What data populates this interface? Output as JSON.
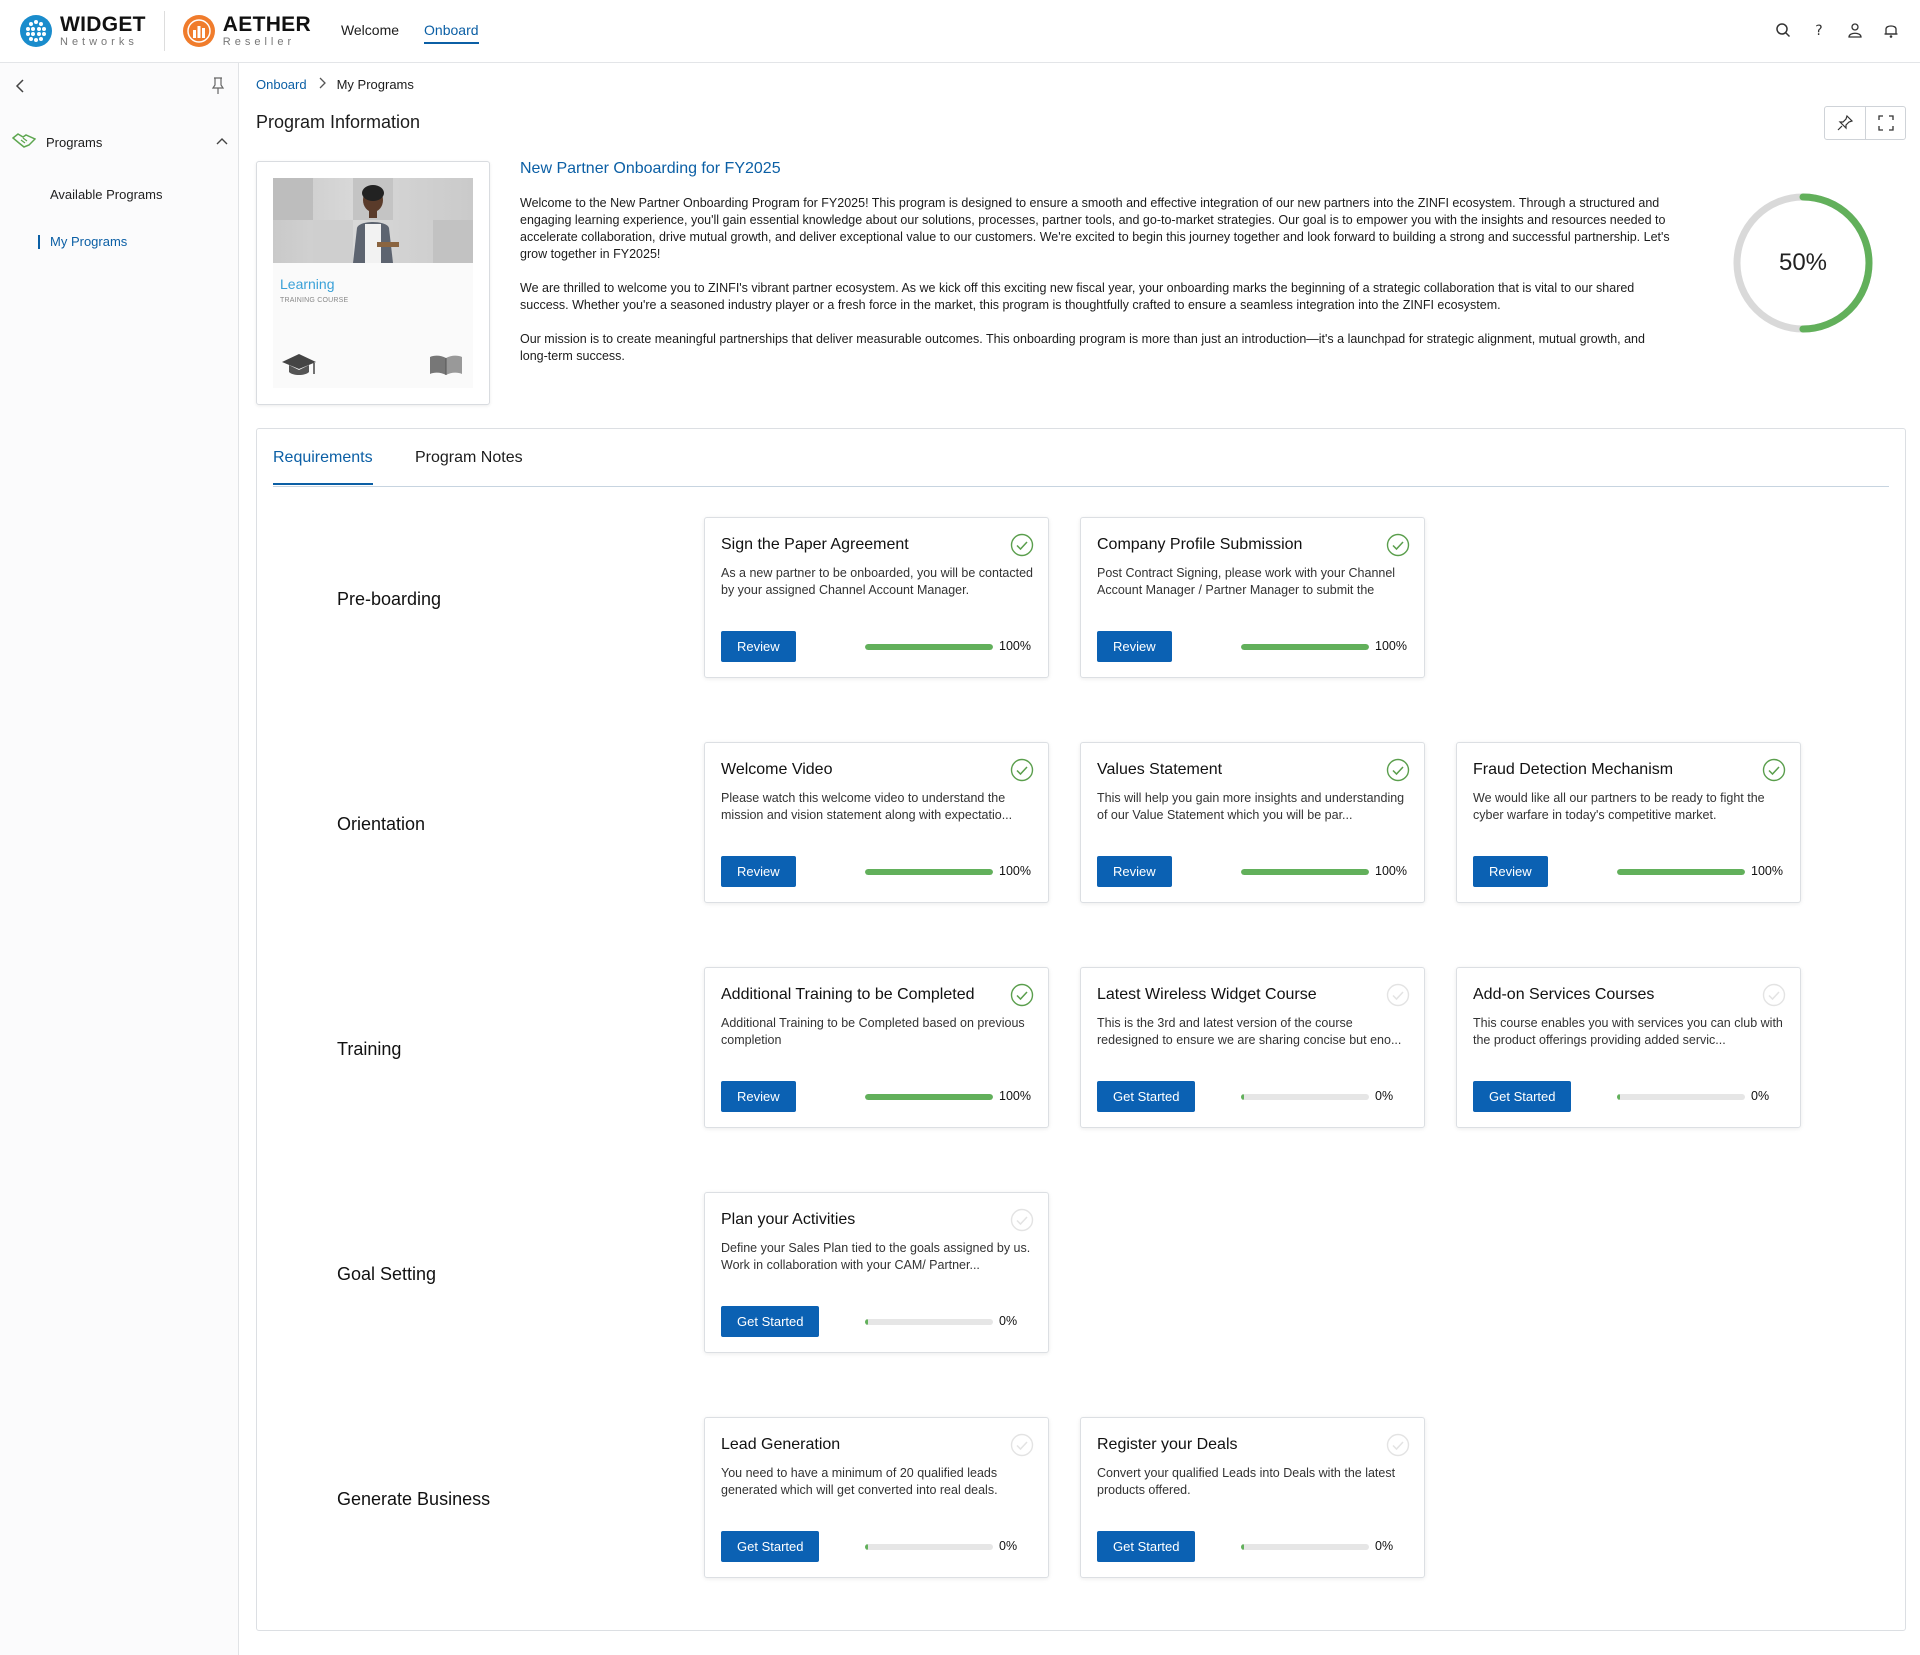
{
  "header": {
    "logo1": {
      "main": "WIDGET",
      "sub": "Networks"
    },
    "logo2": {
      "main": "AETHER",
      "sub": "Reseller"
    },
    "nav": [
      {
        "label": "Welcome",
        "active": false
      },
      {
        "label": "Onboard",
        "active": true
      }
    ],
    "icons": [
      "search-icon",
      "help-icon",
      "user-icon",
      "bell-icon"
    ]
  },
  "sidebar": {
    "section": "Programs",
    "items": [
      {
        "label": "Available Programs",
        "active": false
      },
      {
        "label": "My Programs",
        "active": true
      }
    ]
  },
  "breadcrumb": {
    "root": "Onboard",
    "current": "My Programs"
  },
  "page": {
    "title": "Program Information"
  },
  "program": {
    "thumb_title": "Learning",
    "thumb_subtitle": "TRAINING COURSE",
    "title": "New Partner Onboarding for FY2025",
    "description": [
      "Welcome to the New Partner Onboarding Program for FY2025! This program is designed to ensure a smooth and effective integration of our new partners into the ZINFI ecosystem. Through a structured and engaging learning experience, you'll gain essential knowledge about our solutions, processes, partner tools, and go-to-market strategies. Our goal is to empower you with the insights and resources needed to accelerate collaboration, drive mutual growth, and deliver exceptional value to our customers. We're excited to begin this journey together and look forward to building a strong and successful partnership. Let's grow together in FY2025!",
      "We are thrilled to welcome you to ZINFI's vibrant partner ecosystem. As we kick off this exciting new fiscal year, your onboarding marks the beginning of a strategic collaboration that is vital to our shared success. Whether you're a seasoned industry player or a fresh force in the market, this program is thoughtfully crafted to ensure a seamless integration into the ZINFI ecosystem.",
      "Our mission is to create meaningful partnerships that deliver measurable outcomes. This onboarding program is more than just an introduction—it's a launchpad for strategic alignment, mutual growth, and long-term success."
    ],
    "progress_label": "50%",
    "progress": 0.5
  },
  "tabs": [
    {
      "label": "Requirements",
      "active": true
    },
    {
      "label": "Program Notes",
      "active": false
    }
  ],
  "colors": {
    "accent": "#0b5fa5",
    "button": "#0b61b3",
    "progress": "#62b05b",
    "track": "#d9d9d9"
  },
  "stages": [
    {
      "label": "Pre-boarding",
      "cards": [
        {
          "title": "Sign the Paper Agreement",
          "desc": "As a new partner to be onboarded, you will be contacted by your assigned Channel Account Manager.",
          "button": "Review",
          "progress": 1.0,
          "pct": "100%",
          "done": true
        },
        {
          "title": "Company Profile Submission",
          "desc": "Post Contract Signing, please work with your Channel Account Manager / Partner Manager to submit the",
          "button": "Review",
          "progress": 1.0,
          "pct": "100%",
          "done": true
        }
      ]
    },
    {
      "label": "Orientation",
      "cards": [
        {
          "title": "Welcome Video",
          "desc": "Please watch this welcome video to understand the mission and vision statement along with expectatio...",
          "button": "Review",
          "progress": 1.0,
          "pct": "100%",
          "done": true
        },
        {
          "title": "Values Statement",
          "desc": "This will help you gain more insights and understanding of our Value Statement which you will be par...",
          "button": "Review",
          "progress": 1.0,
          "pct": "100%",
          "done": true
        },
        {
          "title": "Fraud Detection Mechanism",
          "desc": "We would like all our partners to be ready to fight the cyber warfare in today's competitive market.",
          "button": "Review",
          "progress": 1.0,
          "pct": "100%",
          "done": true
        }
      ]
    },
    {
      "label": "Training",
      "cards": [
        {
          "title": "Additional Training to be Completed",
          "desc": "Additional Training to be Completed based on previous completion",
          "button": "Review",
          "progress": 1.0,
          "pct": "100%",
          "done": true
        },
        {
          "title": "Latest Wireless Widget Course",
          "desc": "This is the 3rd and latest version of the course redesigned to ensure we are sharing concise but eno...",
          "button": "Get Started",
          "progress": 0.0,
          "pct": "0%",
          "done": false
        },
        {
          "title": "Add-on Services Courses",
          "desc": "This course enables you with services you can club with the product offerings providing added servic...",
          "button": "Get Started",
          "progress": 0.0,
          "pct": "0%",
          "done": false
        }
      ]
    },
    {
      "label": "Goal Setting",
      "cards": [
        {
          "title": "Plan your Activities",
          "desc": "Define your Sales Plan tied to the goals assigned by us. Work in collaboration with your CAM/ Partner...",
          "button": "Get Started",
          "progress": 0.0,
          "pct": "0%",
          "done": false
        }
      ]
    },
    {
      "label": "Generate Business",
      "cards": [
        {
          "title": "Lead Generation",
          "desc": "You need to have a minimum of 20 qualified leads generated which will get converted into real deals.",
          "button": "Get Started",
          "progress": 0.0,
          "pct": "0%",
          "done": false
        },
        {
          "title": "Register your Deals",
          "desc": "Convert your qualified Leads into Deals with the latest products offered.",
          "button": "Get Started",
          "progress": 0.0,
          "pct": "0%",
          "done": false
        }
      ]
    }
  ]
}
